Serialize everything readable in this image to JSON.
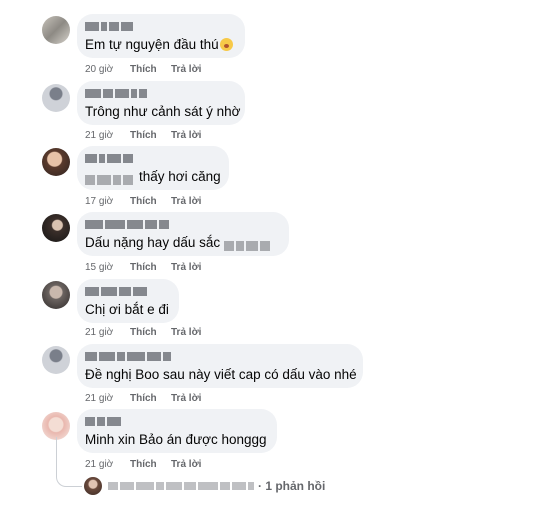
{
  "comments": [
    {
      "text": "Em tự nguyện đầu thú",
      "time": "20 giờ",
      "like": "Thích",
      "reply": "Trả lời",
      "emoji_icon": "face-with-hand-over-mouth-emoji"
    },
    {
      "text": "Trông như cảnh sát ý nhờ",
      "time": "21 giờ",
      "like": "Thích",
      "reply": "Trả lời"
    },
    {
      "text": "thấy hơi căng",
      "time": "17 giờ",
      "like": "Thích",
      "reply": "Trả lời"
    },
    {
      "text": "Dấu nặng hay dấu sắc",
      "time": "15 giờ",
      "like": "Thích",
      "reply": "Trả lời"
    },
    {
      "text": "Chị ơi bắt e đi",
      "time": "21 giờ",
      "like": "Thích",
      "reply": "Trả lời"
    },
    {
      "text": "Đề nghị Boo sau này viết cap có dấu vào nhé",
      "time": "21 giờ",
      "like": "Thích",
      "reply": "Trả lời"
    },
    {
      "text": "Minh xin Bảo án được honggg",
      "time": "21 giờ",
      "like": "Thích",
      "reply": "Trả lời"
    }
  ],
  "replies": {
    "count_label": "· 1 phản hồi"
  },
  "colors": {
    "bubble": "#f0f2f5",
    "meta_text": "#65676b",
    "text": "#050505"
  }
}
